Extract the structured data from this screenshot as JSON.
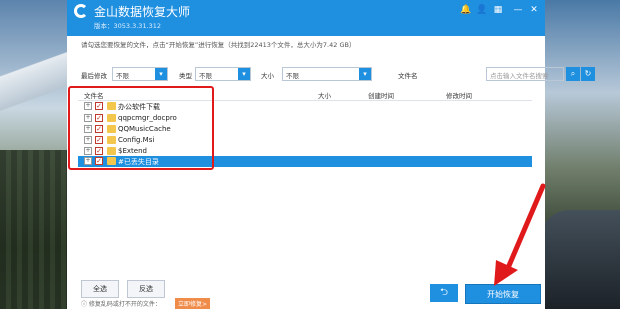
{
  "window": {
    "title": "金山数据恢复大师",
    "version": "版本：3053.3.31.312"
  },
  "titlebar_icons": [
    "bell-icon",
    "person-icon",
    "grid-icon",
    "minimize-icon",
    "close-icon"
  ],
  "hint": "请勾选您要恢复的文件，点击“开始恢复”进行恢复（共找到22413个文件，总大小为7.42 GB）",
  "filters": {
    "modified": {
      "label": "最后修改",
      "value": "不限"
    },
    "type": {
      "label": "类型",
      "value": "不限"
    },
    "size": {
      "label": "大小",
      "value": "不限"
    },
    "filename": {
      "label": "文件名",
      "placeholder": "点击输入文件名搜索"
    }
  },
  "columns": [
    "文件名",
    "大小",
    "创建时间",
    "修改时间"
  ],
  "rows": [
    {
      "name": "办公软件下载",
      "selected": false
    },
    {
      "name": "qqpcmgr_docpro",
      "selected": false
    },
    {
      "name": "QQMusicCache",
      "selected": false
    },
    {
      "name": "Config.Msi",
      "selected": false
    },
    {
      "name": "$Extend",
      "selected": false
    },
    {
      "name": "#已丢失目录",
      "selected": true
    }
  ],
  "buttons": {
    "select_all": "全选",
    "invert": "反选",
    "start": "开始恢复"
  },
  "footer": {
    "note": "修复乱码或打不开的文件：",
    "link": "立即修复>"
  },
  "colors": {
    "accent": "#1f8fe0",
    "highlight": "#e0191b"
  }
}
